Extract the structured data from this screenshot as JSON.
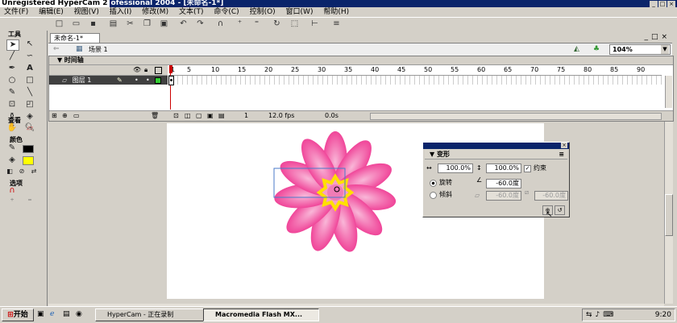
{
  "window": {
    "title_part1": "Unregistered HyperCam 2",
    "title_part2": "ofessional 2004 - [未命名-1*]"
  },
  "menu": [
    "文件(F)",
    "编辑(E)",
    "视图(V)",
    "插入(I)",
    "修改(M)",
    "文本(T)",
    "命令(C)",
    "控制(O)",
    "窗口(W)",
    "帮助(H)"
  ],
  "tools_panel": {
    "title": "工具",
    "view_title": "查看",
    "colors_title": "颜色",
    "options_title": "选项"
  },
  "document": {
    "tab_label": "未命名-1*",
    "scene_label": "场景 1",
    "zoom": "104%"
  },
  "timeline": {
    "title": "时间轴",
    "layer_name": "图层 1",
    "frame_numbers": [
      "1",
      "5",
      "10",
      "15",
      "20",
      "25",
      "30",
      "35",
      "40",
      "45",
      "50",
      "55",
      "60",
      "65",
      "70",
      "75",
      "80",
      "85",
      "90"
    ],
    "current_frame": "1",
    "fps": "12.0 fps",
    "elapsed": "0.0s"
  },
  "transform_panel": {
    "title": "变形",
    "width_pct": "100.0%",
    "height_pct": "100.0%",
    "constrain_label": "约束",
    "rotate_label": "旋转",
    "skew_label": "倾斜",
    "rotate_value": "-60.0度",
    "skew_h": "-60.0度",
    "skew_v": "-60.0度"
  },
  "taskbar": {
    "start": "开始",
    "items": [
      "HyperCam - 正在录制",
      "Macromedia Flash MX..."
    ],
    "time": "9:20"
  },
  "colors": {
    "petal": "#ee2e8c",
    "petal_light": "#f9b7d8",
    "star": "#ffe000",
    "titlebar": "#0a246a"
  }
}
